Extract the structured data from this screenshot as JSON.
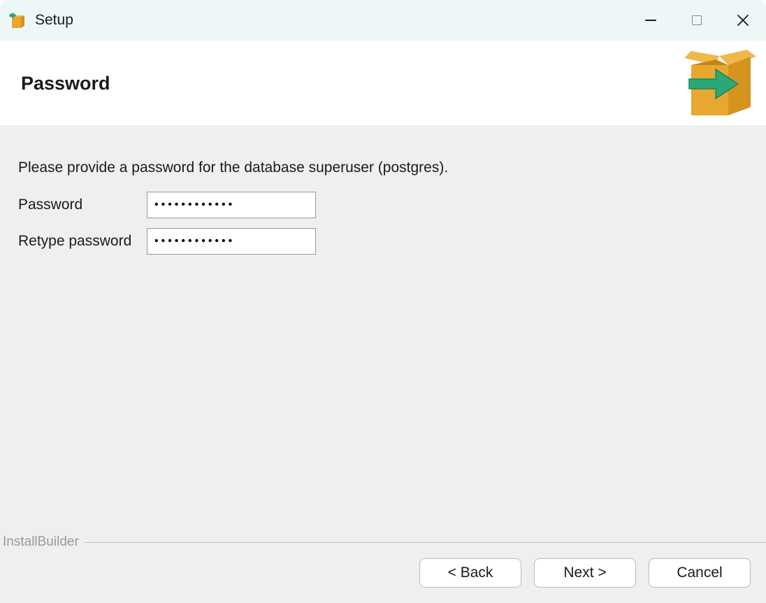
{
  "window": {
    "title": "Setup"
  },
  "header": {
    "title": "Password"
  },
  "main": {
    "instruction": "Please provide a password for the database superuser (postgres).",
    "password_label": "Password",
    "retype_label": "Retype password",
    "password_value": "••••••••••••",
    "retype_value": "••••••••••••"
  },
  "footer": {
    "brand": "InstallBuilder",
    "back_label": "< Back",
    "next_label": "Next >",
    "cancel_label": "Cancel"
  }
}
